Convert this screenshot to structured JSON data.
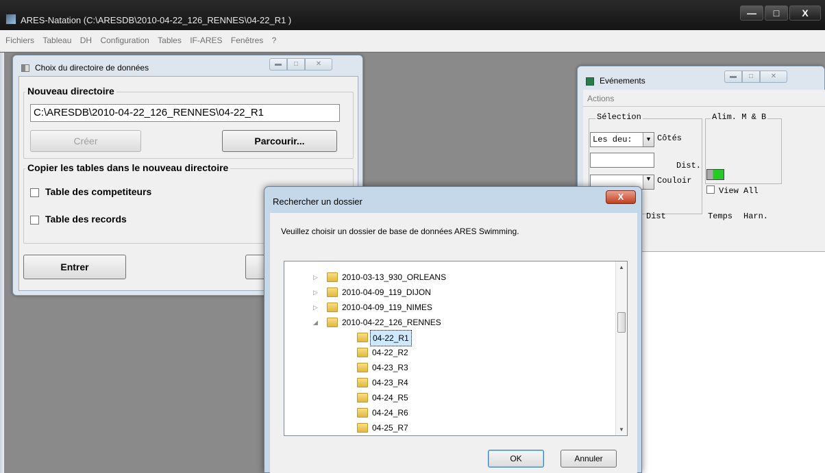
{
  "app": {
    "title": "ARES-Natation (C:\\ARESDB\\2010-04-22_126_RENNES\\04-22_R1 )",
    "minimize": "—",
    "maximize": "□",
    "close": "X"
  },
  "menu": [
    "Fichiers",
    "Tableau",
    "DH",
    "Configuration",
    "Tables",
    "IF-ARES",
    "Fenêtres",
    "?"
  ],
  "choix": {
    "title": "Choix du directoire de données",
    "group_new": "Nouveau directoire",
    "path_value": "C:\\ARESDB\\2010-04-22_126_RENNES\\04-22_R1",
    "create_label": "Créer",
    "browse_label": "Parcourir...",
    "group_copy": "Copier les tables dans le nouveau directoire",
    "chk_competitors": "Table des competiteurs",
    "chk_records": "Table des records",
    "enter_label": "Entrer"
  },
  "evenements": {
    "title": "Evénements",
    "actions": "Actions",
    "selection": "Sélection",
    "alim": "Alim. M & B",
    "combo_cotes": "Les deu:",
    "cotes": "Côtés",
    "dist_field_label": "Dist.",
    "couloir": "Couloir",
    "view_all": "View All",
    "col_dist": "Dist",
    "col_temps": "Temps",
    "col_harn": "Harn.",
    "indicator_color": "#22cc22"
  },
  "dialog": {
    "title": "Rechercher un dossier",
    "close": "X",
    "message": "Veuillez choisir un dossier de base de données ARES Swimming.",
    "tree": [
      {
        "label": "2010-03-13_930_ORLEANS",
        "level": 0,
        "toggle": "▷"
      },
      {
        "label": "2010-04-09_119_DIJON",
        "level": 0,
        "toggle": "▷"
      },
      {
        "label": "2010-04-09_119_NIMES",
        "level": 0,
        "toggle": "▷"
      },
      {
        "label": "2010-04-22_126_RENNES",
        "level": 0,
        "toggle": "◢"
      },
      {
        "label": "04-22_R1",
        "level": 1,
        "toggle": "",
        "selected": true
      },
      {
        "label": "04-22_R2",
        "level": 1,
        "toggle": ""
      },
      {
        "label": "04-23_R3",
        "level": 1,
        "toggle": ""
      },
      {
        "label": "04-23_R4",
        "level": 1,
        "toggle": ""
      },
      {
        "label": "04-24_R5",
        "level": 1,
        "toggle": ""
      },
      {
        "label": "04-24_R6",
        "level": 1,
        "toggle": ""
      },
      {
        "label": "04-25_R7",
        "level": 1,
        "toggle": ""
      }
    ],
    "scroll_up": "▲",
    "scroll_down": "▼",
    "ok_label": "OK",
    "cancel_label": "Annuler"
  }
}
